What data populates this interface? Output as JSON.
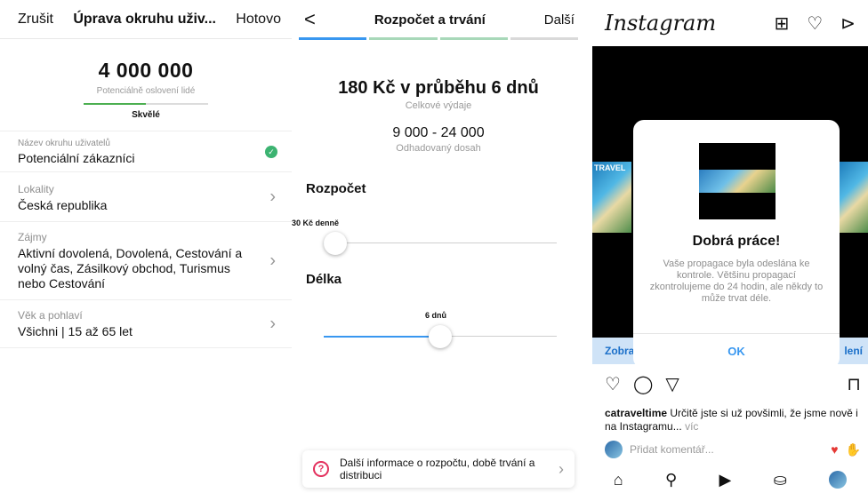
{
  "screen1": {
    "cancel": "Zrušit",
    "title": "Úprava okruhu uživ...",
    "done": "Hotovo",
    "reach_value": "4 000 000",
    "reach_label": "Potenciálně oslovení lidé",
    "reach_level": 0.5,
    "rating": "Skvělé",
    "rows": [
      {
        "label": "Název okruhu uživatelů",
        "value": "Potenciální zákazníci"
      },
      {
        "label": "Lokality",
        "value": "Česká republika"
      },
      {
        "label": "Zájmy",
        "value": "Aktivní dovolená, Dovolená, Cestování a volný čas, Zásilkový obchod, Turismus nebo Cestování"
      },
      {
        "label": "Věk a pohlaví",
        "value": "Všichni | 15 až 65 let"
      }
    ]
  },
  "screen2": {
    "back": "<",
    "title": "Rozpočet a trvání",
    "next": "Další",
    "summary": "180 Kč v průběhu 6 dnů",
    "summary_label": "Celkové výdaje",
    "reach_range": "9 000 - 24 000",
    "reach_label": "Odhadovaný dosah",
    "budget_header": "Rozpočet",
    "budget_value": "30 Kč denně",
    "duration_header": "Délka",
    "duration_value": "6 dnů",
    "budget_level": 0.05,
    "duration_level": 0.5,
    "info_text": "Další informace o rozpočtu, době trvání a distribuci"
  },
  "screen3": {
    "logo": "Instagram",
    "dialog_title": "Dobrá práce!",
    "dialog_body": "Vaše propagace byla odeslána ke kontrole. Většinu propagací zkontrolujeme do 24 hodin, ale někdy to může trvat déle.",
    "ok": "OK",
    "link_left": "Zobra",
    "link_right": "lení",
    "caption_user": "catraveltime",
    "caption_text": "Určitě jste si už povšimli, že jsme nově i na Instagramu...",
    "caption_more": "víc",
    "comment_placeholder": "Přidat komentář...",
    "travel_text": "TRAVEL"
  }
}
